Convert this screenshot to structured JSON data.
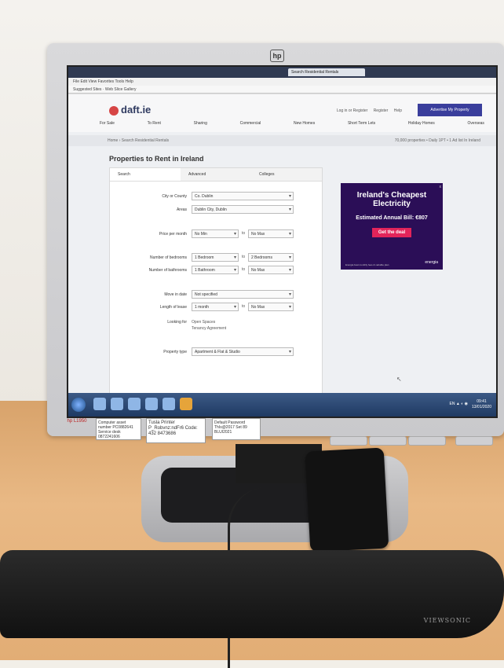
{
  "monitor": {
    "brand_mark": "hp",
    "bezel_logo": "hp L1950"
  },
  "browser": {
    "tab_active": "Search Residential Rentals",
    "menu": "File  Edit  View  Favorites  Tools  Help",
    "favorites": "Suggested Sites  ·  Web Slice Gallery"
  },
  "site": {
    "logo": "daft.ie",
    "header_links": [
      "Log in or Register",
      "Register",
      "Help"
    ],
    "advertise_button": "Advertise My Property",
    "nav": [
      "For Sale",
      "To Rent",
      "Sharing",
      "Commercial",
      "New Homes",
      "Short Term Lets",
      "Holiday Homes",
      "Overseas"
    ],
    "breadcrumb": "Home › Search Residential Rentals",
    "photo_notice": "70,000 properties • Daily 1PT • 1 Ad list In Ireland",
    "page_title": "Properties to Rent in Ireland",
    "search_tabs": [
      "Search",
      "Advanced",
      "Colleges"
    ],
    "form": [
      {
        "label": "City or County",
        "value": "Co. Dublin"
      },
      {
        "label": "Areas",
        "value": "Dublin City, Dublin"
      },
      {
        "label": "Price per month",
        "from": "No Min",
        "to_text": "to",
        "to": "No Max"
      },
      {
        "label": "Number of bedrooms",
        "from": "1 Bedroom",
        "to_text": "to",
        "to": "2 Bedrooms"
      },
      {
        "label": "Number of bathrooms",
        "from": "1 Bathroom",
        "to_text": "to",
        "to": "No Max"
      },
      {
        "label": "Move in date",
        "value": "Not specified"
      },
      {
        "label": "Length of lease",
        "from": "1 month",
        "to_text": "to",
        "to": "No Max"
      },
      {
        "label": "Looking for",
        "facilities": [
          "Open Spaces",
          "Tenancy Agreement"
        ]
      },
      {
        "label": "Property type",
        "value": "Apartment & Flat & Studio"
      }
    ]
  },
  "ad": {
    "title": "Ireland's Cheapest Electricity",
    "subtitle": "Estimated Annual Bill: €807",
    "button": "Get the deal",
    "brand": "energia",
    "fine_print": "Energia best monthly fees & variable plan",
    "close": "x"
  },
  "taskbar": {
    "tray_text": "EN  ▲  ◐  ◉",
    "time": "09:41",
    "date": "13/01/2020"
  },
  "stickers": {
    "s1": "Computer asset number PC0882641 Service desk 0872241606",
    "s2": "Tusla Printer P_Robvnz:ndFr6 Code: 432 8473686",
    "s3": "Default Password ThIs@2017 Set 89 BLUI2021"
  },
  "wrist_rest": "VIEWSONIC",
  "colors": {
    "brand_primary": "#3a3e9c",
    "ad_background": "#2b0e57",
    "ad_button": "#e2245a",
    "desk": "#e9b985"
  }
}
